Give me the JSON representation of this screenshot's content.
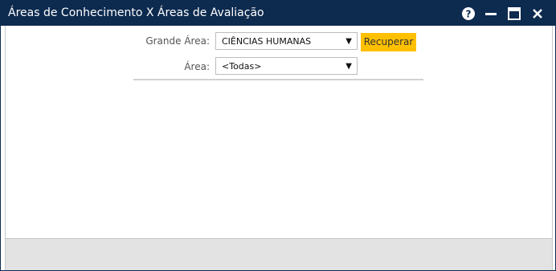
{
  "window": {
    "title": "Áreas de Conhecimento X Áreas de Avaliação",
    "titlebar_color": "#0d2a4f",
    "buttons": {
      "help_icon": "help-icon",
      "minimize_icon": "minimize-icon",
      "maximize_icon": "maximize-icon",
      "close_icon": "close-icon"
    }
  },
  "form": {
    "grande_area": {
      "label": "Grande Área:",
      "selected": "CIÊNCIAS HUMANAS"
    },
    "area": {
      "label": "Área:",
      "selected": "<Todas>"
    },
    "recuperar_label": "Recuperar",
    "accent_color": "#ffc000"
  }
}
